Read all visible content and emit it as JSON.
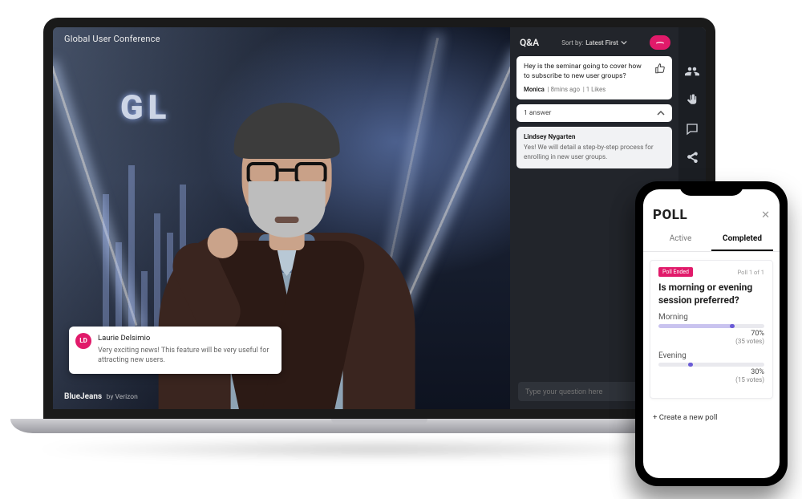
{
  "app_title": "Global User Conference",
  "stage_text": "GL",
  "brand": {
    "name": "BlueJeans",
    "byline": "by Verizon"
  },
  "comment": {
    "avatar_initials": "LD",
    "author": "Laurie Delsimio",
    "text": "Very exciting news! This feature will be very useful for attracting new users."
  },
  "qa": {
    "title": "Q&A",
    "sort_label": "Sort by:",
    "sort_value": "Latest First",
    "question": {
      "text": "Hey is the seminar going to cover how to subscribe to new user groups?",
      "author": "Monica",
      "time": "8mins ago",
      "likes": "1 Likes"
    },
    "answers_header": "1 answer",
    "answer": {
      "author": "Lindsey Nygarten",
      "text": "Yes! We will detail a step-by-step process for enrolling in new user groups."
    },
    "input_placeholder": "Type your question here",
    "badge": "Q&A"
  },
  "poll": {
    "title": "POLL",
    "tab_active": "Active",
    "tab_completed": "Completed",
    "badge": "Poll Ended",
    "poll_of": "Poll 1 of 1",
    "question": "Is morning or evening session preferred?",
    "opt1": {
      "label": "Morning",
      "pct": "70%",
      "votes": "(35 votes)",
      "width": "70%",
      "cap": "70%"
    },
    "opt2": {
      "label": "Evening",
      "pct": "30%",
      "votes": "(15 votes)",
      "width": "30%",
      "cap": "30%"
    },
    "create": "Create a new poll"
  }
}
